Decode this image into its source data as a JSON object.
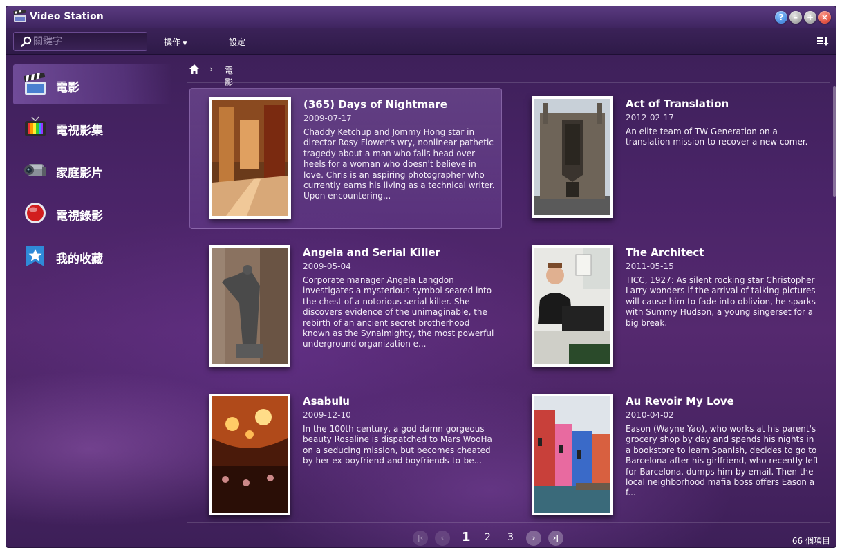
{
  "app": {
    "title": "Video Station"
  },
  "toolbar": {
    "search_placeholder": "關鍵字",
    "actions_label": "操作",
    "settings_label": "設定"
  },
  "sidebar": {
    "items": [
      {
        "label": "電影",
        "icon": "clapperboard-icon"
      },
      {
        "label": "電視影集",
        "icon": "tv-icon"
      },
      {
        "label": "家庭影片",
        "icon": "camcorder-icon"
      },
      {
        "label": "電視錄影",
        "icon": "record-icon"
      },
      {
        "label": "我的收藏",
        "icon": "star-icon"
      }
    ]
  },
  "breadcrumb": {
    "current": "電影"
  },
  "movies": [
    {
      "title": "(365) Days of Nightmare",
      "date": "2009-07-17",
      "description": "Chaddy Ketchup and Jommy Hong star in director Rosy Flower's wry, nonlinear pathetic tragedy about a man who falls head over heels for a woman who doesn't believe in love. Chris is an aspiring photographer who currently earns his living as a technical writer. Upon encountering..."
    },
    {
      "title": "Act of Translation",
      "date": "2012-02-17",
      "description": "An elite team of TW Generation on a translation mission to recover a new comer."
    },
    {
      "title": "Angela and Serial Killer",
      "date": "2009-05-04",
      "description": "Corporate manager Angela Langdon investigates a mysterious symbol seared into the chest of a notorious serial killer. She discovers evidence of the unimaginable, the rebirth of an ancient secret brotherhood known as the Synalmighty, the most powerful underground organization e..."
    },
    {
      "title": "The Architect",
      "date": "2011-05-15",
      "description": "TICC, 1927: As silent rocking star Christopher Larry wonders if the arrival of talking pictures will cause him to fade into oblivion, he sparks with Summy Hudson, a young singerset for a big break."
    },
    {
      "title": "Asabulu",
      "date": "2009-12-10",
      "description": "In the 100th century, a god damn gorgeous beauty Rosaline is dispatched to Mars WooHa on a seducing mission, but becomes cheated by her ex-boyfriend and boyfriends-to-be..."
    },
    {
      "title": "Au Revoir My Love",
      "date": "2010-04-02",
      "description": "Eason (Wayne Yao), who works at his parent's grocery shop by day and spends his nights in a bookstore to learn Spanish, decides to go to Barcelona after his girlfriend, who recently left for Barcelona, dumps him by email. Then the local neighborhood mafia boss offers Eason a f..."
    }
  ],
  "pager": {
    "pages": [
      "1",
      "2",
      "3"
    ],
    "current": "1",
    "item_count": "66 個項目"
  }
}
